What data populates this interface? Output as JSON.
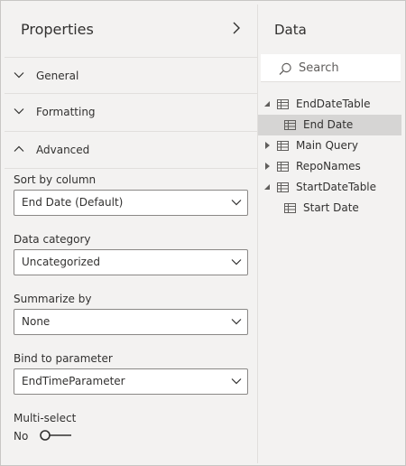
{
  "properties": {
    "title": "Properties",
    "sections": [
      {
        "label": "General",
        "expanded": false
      },
      {
        "label": "Formatting",
        "expanded": false
      },
      {
        "label": "Advanced",
        "expanded": true
      }
    ],
    "fields": {
      "sort_by": {
        "label": "Sort by column",
        "value": "End Date (Default)"
      },
      "data_category": {
        "label": "Data category",
        "value": "Uncategorized"
      },
      "summarize_by": {
        "label": "Summarize by",
        "value": "None"
      },
      "bind_to_parameter": {
        "label": "Bind to parameter",
        "value": "EndTimeParameter"
      },
      "multi_select": {
        "label": "Multi-select",
        "value": "No",
        "on": false
      }
    }
  },
  "data": {
    "title": "Data",
    "search_placeholder": "Search",
    "tree": [
      {
        "label": "EndDateTable",
        "level": 0,
        "expanded": true,
        "selected": false
      },
      {
        "label": "End Date",
        "level": 1,
        "selected": true
      },
      {
        "label": "Main Query",
        "level": 0,
        "expanded": false,
        "selected": false
      },
      {
        "label": "RepoNames",
        "level": 0,
        "expanded": false,
        "selected": false
      },
      {
        "label": "StartDateTable",
        "level": 0,
        "expanded": true,
        "selected": false
      },
      {
        "label": "Start Date",
        "level": 1,
        "selected": false
      }
    ]
  },
  "colors": {
    "panel_bg": "#f3f2f1",
    "text": "#323130",
    "border": "#8a8886",
    "selected_row": "#d6d5d4"
  }
}
